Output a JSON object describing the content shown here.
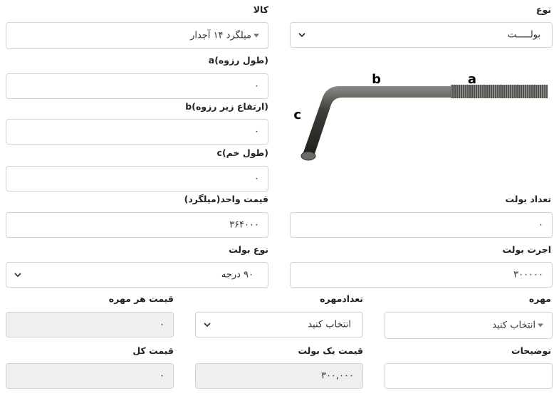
{
  "labels": {
    "type": "نوع",
    "product": "کالا",
    "thread_length": "a(طول رزوه)",
    "under_thread_height": "b(ارتفاع زیر رزوه)",
    "bend_length": "c(طول خم)",
    "unit_price": "قیمت واحد(میلگرد)",
    "bolt_count": "تعداد بولت",
    "bolt_type": "نوع بولت",
    "bolt_wage": "اجرت بولت",
    "nut": "مهره",
    "nut_count": "تعدادمهره",
    "nut_price": "قیمت هر مهره",
    "description": "توضیحات",
    "single_bolt_price": "قیمت یک بولت",
    "total_price": "قیمت کل"
  },
  "values": {
    "type": "بولـــــت",
    "product": "میلگرد ۱۴ آجدار",
    "thread_length": "۰",
    "under_thread_height": "۰",
    "bend_length": "۰",
    "unit_price": "۳۶۴۰۰۰",
    "bolt_count": "۰",
    "bolt_type": "۹۰ درجه",
    "bolt_wage": "۳۰۰۰۰۰",
    "nut": "انتخاب کنید",
    "nut_count": "انتخاب کنید",
    "nut_price": "۰",
    "description": "",
    "single_bolt_price": "۳۰۰,۰۰۰",
    "total_price": "۰"
  },
  "image": {
    "label_a": "a",
    "label_b": "b",
    "label_c": "c",
    "icon": "anchor-bolt-diagram"
  },
  "colors": {
    "border": "#cfd4da",
    "readonly_bg": "#eeeff1",
    "text": "#222222"
  }
}
